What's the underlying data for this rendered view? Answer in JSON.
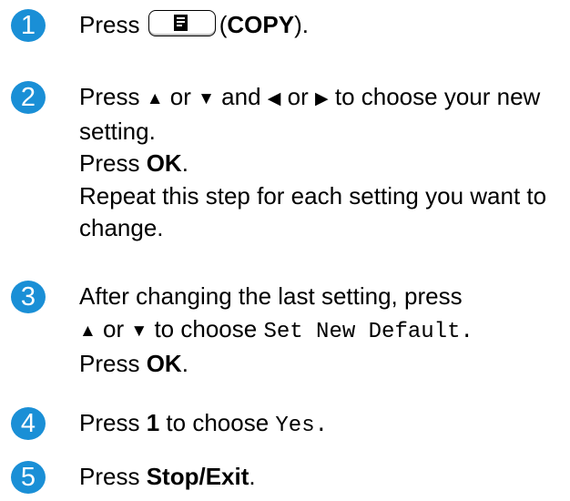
{
  "accent_color": "#1a8fd6",
  "steps": [
    {
      "number": "1",
      "press": "Press",
      "key_icon": "copy-key-icon",
      "paren_open": "(",
      "key_label": "COPY",
      "paren_close": ")."
    },
    {
      "number": "2",
      "press": "Press",
      "up": "▲",
      "or1": "or",
      "down": "▼",
      "and": "and",
      "left": "◀",
      "or2": "or",
      "right": "▶",
      "tail": "to choose your new setting.",
      "press_ok_prefix": "Press",
      "ok": "OK",
      "period": ".",
      "repeat": "Repeat this step for each setting you want to change."
    },
    {
      "number": "3",
      "line1": "After changing the last setting, press",
      "up": "▲",
      "or": "or",
      "down": "▼",
      "to_choose": "to choose",
      "option": "Set New Default",
      "period": ".",
      "press_ok_prefix": "Press",
      "ok": "OK",
      "period2": "."
    },
    {
      "number": "4",
      "press": "Press",
      "key": "1",
      "to_choose": "to choose",
      "option": "Yes",
      "period": "."
    },
    {
      "number": "5",
      "press": "Press",
      "key": "Stop/Exit",
      "period": "."
    }
  ]
}
